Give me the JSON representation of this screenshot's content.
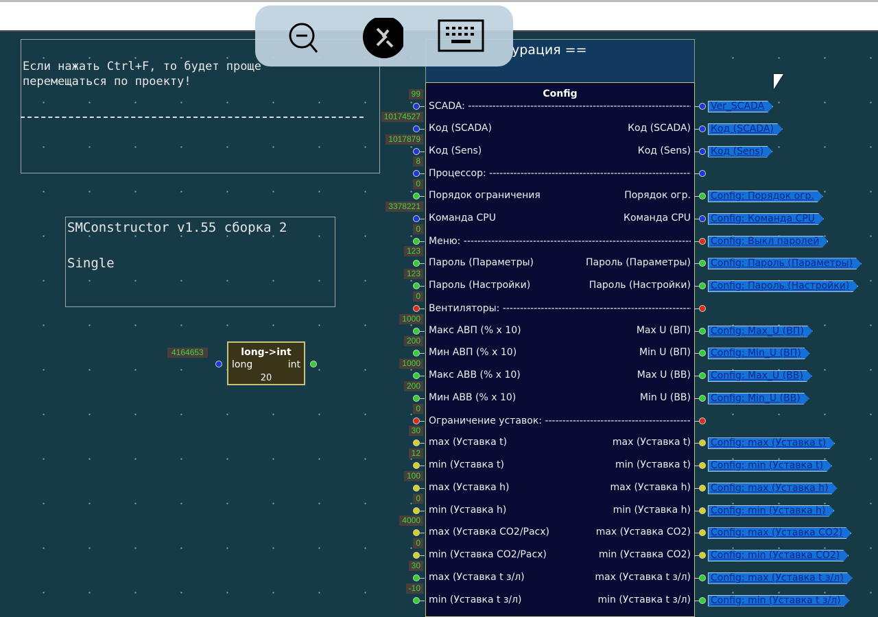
{
  "notes": {
    "hint": "Если нажать Ctrl+F, то будет проще\nперемещаться по проекту!",
    "version": "SMConstructor v1.55 сборка 2\n\nSingle"
  },
  "group_title": "урация ==",
  "block": {
    "title": "Config",
    "rows": [
      {
        "v": "99",
        "c": "#1a3adf",
        "l": "SCADA:",
        "sep": true,
        "rc": "#1a3adf",
        "tag": "Ver_SCADA"
      },
      {
        "v": "10174527",
        "c": "#1a3adf",
        "l": "Код (SCADA)",
        "r": "Код (SCADA)",
        "rc": "#1a3adf",
        "tag": "Код (SCADA)"
      },
      {
        "v": "1017879",
        "c": "#1a3adf",
        "l": "Код (Sens)",
        "r": "Код (Sens)",
        "rc": "#1a3adf",
        "tag": "Код (Sens)"
      },
      {
        "v": "8",
        "c": "#1a3adf",
        "l": "Процессор:",
        "sep": true,
        "rc": "#1a3adf"
      },
      {
        "v": "0",
        "c": "#2ed12e",
        "l": "Порядок ограничения",
        "r": "Порядок огр.",
        "rc": "#2ed12e",
        "tag": "Config: Порядок огр."
      },
      {
        "v": "3378221",
        "c": "#1a3adf",
        "l": "Команда CPU",
        "r": "Команда CPU",
        "rc": "#1a3adf",
        "tag": "Config: Команда CPU"
      },
      {
        "v": "0",
        "c": "#2ed12e",
        "l": "Меню:",
        "sep": true,
        "rc": "#e02a1a",
        "tag": "Config: Выкл паролей"
      },
      {
        "v": "123",
        "c": "#2ed12e",
        "l": "Пароль (Параметры)",
        "r": "Пароль (Параметры)",
        "rc": "#2ed12e",
        "tag": "Config: Пароль (Параметры)"
      },
      {
        "v": "123",
        "c": "#2ed12e",
        "l": "Пароль (Настройки)",
        "r": "Пароль (Настройки)",
        "rc": "#2ed12e",
        "tag": "Config: Пароль (Настройки)"
      },
      {
        "v": "0",
        "c": "#e02a1a",
        "l": "Вентиляторы:",
        "sep": true,
        "rc": "#e02a1a"
      },
      {
        "v": "1000",
        "c": "#2ed12e",
        "l": "Макс АВП (% x 10)",
        "r": "Max  U (ВП)",
        "rc": "#2ed12e",
        "tag": "Config: Max_U (ВП)"
      },
      {
        "v": "200",
        "c": "#2ed12e",
        "l": "Мин АВП (% x 10)",
        "r": "Min  U (ВП)",
        "rc": "#2ed12e",
        "tag": "Config: Min_U (ВП)"
      },
      {
        "v": "1000",
        "c": "#2ed12e",
        "l": "Макс АВВ (% x 10)",
        "r": "Max  U (ВВ)",
        "rc": "#2ed12e",
        "tag": "Config: Max_U (ВВ)"
      },
      {
        "v": "200",
        "c": "#2ed12e",
        "l": "Мин АВВ (% x 10)",
        "r": "Min  U (ВВ)",
        "rc": "#2ed12e",
        "tag": "Config: Min_U (ВВ)"
      },
      {
        "v": "0",
        "c": "#e02a1a",
        "l": "Ограничение уставок:",
        "sep": true,
        "rc": "#e02a1a"
      },
      {
        "v": "30",
        "c": "#d8cf20",
        "l": "max (Уставка t)",
        "r": "max (Уставка t)",
        "rc": "#d8cf20",
        "tag": "Config: max (Уставка t)"
      },
      {
        "v": "12",
        "c": "#d8cf20",
        "l": "min (Уставка t)",
        "r": "min (Уставка t)",
        "rc": "#d8cf20",
        "tag": "Config: min (Уставка t)"
      },
      {
        "v": "100",
        "c": "#d8cf20",
        "l": "max (Уставка h)",
        "r": "max (Уставка h)",
        "rc": "#d8cf20",
        "tag": "Config: max (Уставка h)"
      },
      {
        "v": "0",
        "c": "#d8cf20",
        "l": "min (Уставка h)",
        "r": "min (Уставка h)",
        "rc": "#d8cf20",
        "tag": "Config: min (Уставка h)"
      },
      {
        "v": "4000",
        "c": "#d8cf20",
        "l": "max (Уставка CO2/Расх)",
        "r": "max (Уставка CO2)",
        "rc": "#d8cf20",
        "tag": "Config: max (Уставка CO2)"
      },
      {
        "v": "0",
        "c": "#d8cf20",
        "l": "min (Уставка CO2/Расх)",
        "r": "min (Уставка CO2)",
        "rc": "#d8cf20",
        "tag": "Config: min (Уставка CO2)"
      },
      {
        "v": "30",
        "c": "#2ed12e",
        "l": "max (Уставка t з/л)",
        "r": "max (Уставка t з/л)",
        "rc": "#2ed12e",
        "tag": "Config: max (Уставка t з/л)"
      },
      {
        "v": "-10",
        "c": "#2ed12e",
        "l": "min (Уставка t з/л)",
        "r": "min (Уставка t з/л)",
        "rc": "#2ed12e",
        "tag": "Config: min (Уставка t з/л)"
      }
    ]
  },
  "converter": {
    "title": "long->int",
    "input": "long",
    "output": "int",
    "number": "20",
    "value": "4164653"
  },
  "overlay": {
    "icons": [
      "zoom-out-icon",
      "remote-desktop-icon",
      "keyboard-icon"
    ]
  }
}
